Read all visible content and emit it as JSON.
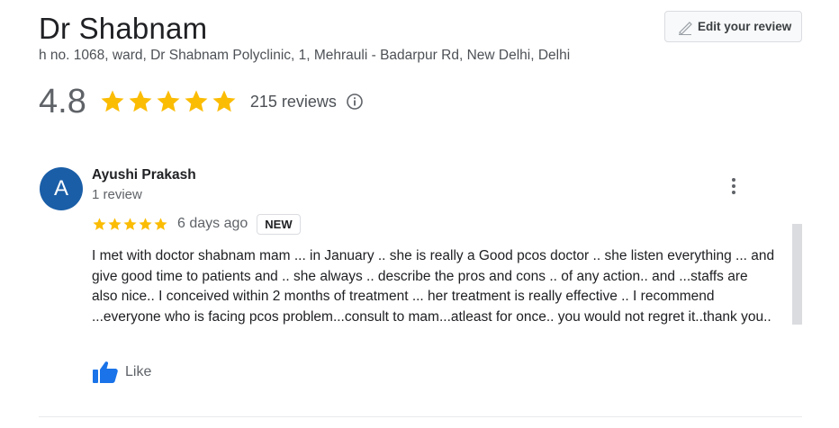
{
  "place": {
    "title": "Dr Shabnam",
    "address": "h no. 1068, ward, Dr Shabnam Polyclinic, 1, Mehrauli - Badarpur Rd, New Delhi, Delhi"
  },
  "edit_button": {
    "label": "Edit your review",
    "icon": "pencil-icon"
  },
  "summary": {
    "rating": "4.8",
    "stars": 5,
    "review_count": "215 reviews",
    "info_icon": "info-icon"
  },
  "review": {
    "avatar_letter": "A",
    "reviewer_name": "Ayushi Prakash",
    "reviewer_meta": "1 review",
    "stars": 5,
    "date": "6 days ago",
    "badge": "NEW",
    "text": "I met with doctor shabnam mam ... in January .. she is really a Good pcos doctor .. she listen everything ... and give good time to patients  and .. she always .. describe the pros and cons .. of any action.. and ...staffs are also nice.. I conceived within 2 months of treatment ... her treatment is really  effective .. I recommend  ...everyone who is facing pcos problem...consult to mam...atleast for once.. you would not regret it..thank you..",
    "like_label": "Like"
  },
  "colors": {
    "star": "#fbbc04",
    "avatar_bg": "#1a5ea7",
    "like_blue": "#1a73e8"
  }
}
